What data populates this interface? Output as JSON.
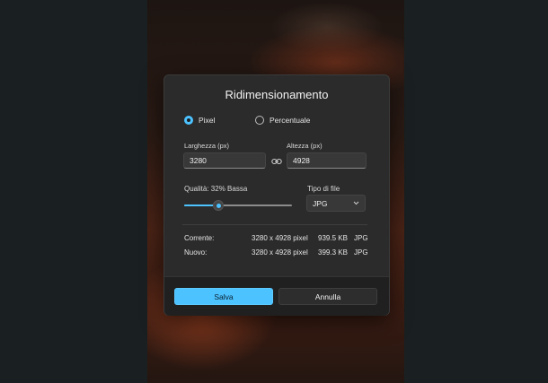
{
  "dialog": {
    "title": "Ridimensionamento",
    "mode": {
      "options": [
        {
          "label": "Pixel",
          "selected": true
        },
        {
          "label": "Percentuale",
          "selected": false
        }
      ]
    },
    "width": {
      "label": "Larghezza (px)",
      "value": "3280"
    },
    "height": {
      "label": "Altezza (px)",
      "value": "4928"
    },
    "link_icon": "link-chain-icon",
    "quality": {
      "label": "Qualità: 32% Bassa",
      "value_percent": 32
    },
    "file_type": {
      "label": "Tipo di file",
      "selected": "JPG"
    },
    "info": {
      "current": {
        "label": "Corrente:",
        "dimensions": "3280 x 4928 pixel",
        "size": "939.5 KB",
        "format": "JPG"
      },
      "new": {
        "label": "Nuovo:",
        "dimensions": "3280 x 4928 pixel",
        "size": "399.3 KB",
        "format": "JPG"
      }
    },
    "buttons": {
      "save": "Salva",
      "cancel": "Annulla"
    }
  },
  "colors": {
    "accent": "#4cc2ff",
    "dialog_bg": "#2b2b2b",
    "footer_bg": "#202020"
  }
}
